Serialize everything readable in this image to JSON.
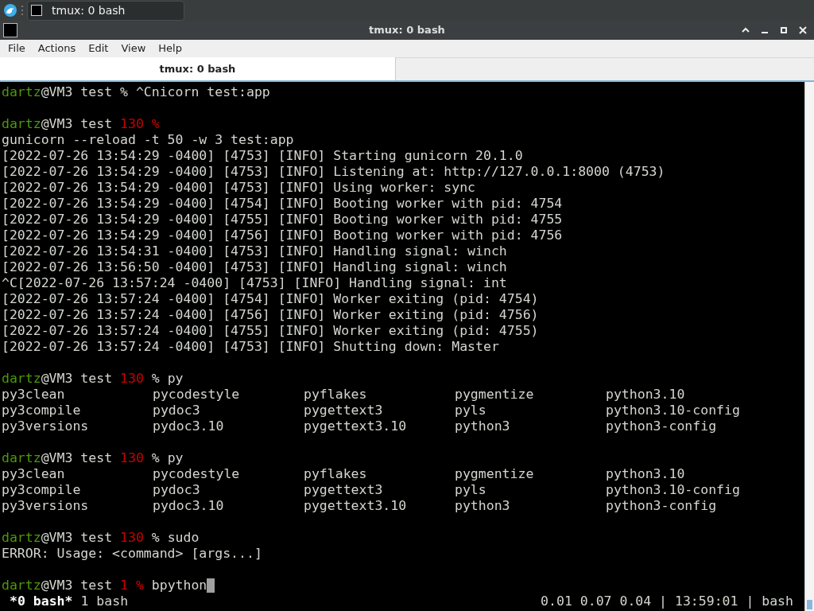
{
  "taskbar": {
    "task": {
      "label": "tmux: 0 bash",
      "selected": true
    }
  },
  "window": {
    "title": "tmux: 0 bash"
  },
  "menu": [
    "File",
    "Actions",
    "Edit",
    "View",
    "Help"
  ],
  "tabs": [
    {
      "label": "tmux: 0 bash",
      "selected": true
    }
  ],
  "terminal": [
    {
      "kind": "text",
      "segments": [
        {
          "text": "dartz",
          "color": "#4e9a06"
        },
        {
          "text": "@VM3 test % ^Cnicorn test:app",
          "color": "#d3d7cf"
        }
      ]
    },
    {
      "kind": "blank"
    },
    {
      "kind": "text",
      "segments": [
        {
          "text": "dartz",
          "color": "#4e9a06"
        },
        {
          "text": "@VM3 test ",
          "color": "#d3d7cf"
        },
        {
          "text": "130 %",
          "color": "#cc0000"
        }
      ]
    },
    {
      "kind": "text",
      "segments": [
        {
          "text": "gunicorn --reload -t 50 -w 3 test:app",
          "color": "#d3d7cf"
        }
      ]
    },
    {
      "kind": "text",
      "segments": [
        {
          "text": "[2022-07-26 13:54:29 -0400] [4753] [INFO] Starting gunicorn 20.1.0",
          "color": "#d3d7cf"
        }
      ]
    },
    {
      "kind": "text",
      "segments": [
        {
          "text": "[2022-07-26 13:54:29 -0400] [4753] [INFO] Listening at: http://127.0.0.1:8000 (4753)",
          "color": "#d3d7cf"
        }
      ]
    },
    {
      "kind": "text",
      "segments": [
        {
          "text": "[2022-07-26 13:54:29 -0400] [4753] [INFO] Using worker: sync",
          "color": "#d3d7cf"
        }
      ]
    },
    {
      "kind": "text",
      "segments": [
        {
          "text": "[2022-07-26 13:54:29 -0400] [4754] [INFO] Booting worker with pid: 4754",
          "color": "#d3d7cf"
        }
      ]
    },
    {
      "kind": "text",
      "segments": [
        {
          "text": "[2022-07-26 13:54:29 -0400] [4755] [INFO] Booting worker with pid: 4755",
          "color": "#d3d7cf"
        }
      ]
    },
    {
      "kind": "text",
      "segments": [
        {
          "text": "[2022-07-26 13:54:29 -0400] [4756] [INFO] Booting worker with pid: 4756",
          "color": "#d3d7cf"
        }
      ]
    },
    {
      "kind": "text",
      "segments": [
        {
          "text": "[2022-07-26 13:54:31 -0400] [4753] [INFO] Handling signal: winch",
          "color": "#d3d7cf"
        }
      ]
    },
    {
      "kind": "text",
      "segments": [
        {
          "text": "[2022-07-26 13:56:50 -0400] [4753] [INFO] Handling signal: winch",
          "color": "#d3d7cf"
        }
      ]
    },
    {
      "kind": "text",
      "segments": [
        {
          "text": "^C[2022-07-26 13:57:24 -0400] [4753] [INFO] Handling signal: int",
          "color": "#d3d7cf"
        }
      ]
    },
    {
      "kind": "text",
      "segments": [
        {
          "text": "[2022-07-26 13:57:24 -0400] [4754] [INFO] Worker exiting (pid: 4754)",
          "color": "#d3d7cf"
        }
      ]
    },
    {
      "kind": "text",
      "segments": [
        {
          "text": "[2022-07-26 13:57:24 -0400] [4756] [INFO] Worker exiting (pid: 4756)",
          "color": "#d3d7cf"
        }
      ]
    },
    {
      "kind": "text",
      "segments": [
        {
          "text": "[2022-07-26 13:57:24 -0400] [4755] [INFO] Worker exiting (pid: 4755)",
          "color": "#d3d7cf"
        }
      ]
    },
    {
      "kind": "text",
      "segments": [
        {
          "text": "[2022-07-26 13:57:24 -0400] [4753] [INFO] Shutting down: Master",
          "color": "#d3d7cf"
        }
      ]
    },
    {
      "kind": "blank"
    },
    {
      "kind": "text",
      "segments": [
        {
          "text": "dartz",
          "color": "#4e9a06"
        },
        {
          "text": "@VM3 test ",
          "color": "#d3d7cf"
        },
        {
          "text": "130",
          "color": "#cc0000"
        },
        {
          "text": " % py",
          "color": "#d3d7cf"
        }
      ]
    },
    {
      "kind": "columns",
      "cells": [
        "py3clean",
        "pycodestyle",
        "pyflakes",
        "pygmentize",
        "python3.10"
      ]
    },
    {
      "kind": "columns",
      "cells": [
        "py3compile",
        "pydoc3",
        "pygettext3",
        "pyls",
        "python3.10-config"
      ]
    },
    {
      "kind": "columns",
      "cells": [
        "py3versions",
        "pydoc3.10",
        "pygettext3.10",
        "python3",
        "python3-config"
      ]
    },
    {
      "kind": "blank"
    },
    {
      "kind": "text",
      "segments": [
        {
          "text": "dartz",
          "color": "#4e9a06"
        },
        {
          "text": "@VM3 test ",
          "color": "#d3d7cf"
        },
        {
          "text": "130",
          "color": "#cc0000"
        },
        {
          "text": " % py",
          "color": "#d3d7cf"
        }
      ]
    },
    {
      "kind": "columns",
      "cells": [
        "py3clean",
        "pycodestyle",
        "pyflakes",
        "pygmentize",
        "python3.10"
      ]
    },
    {
      "kind": "columns",
      "cells": [
        "py3compile",
        "pydoc3",
        "pygettext3",
        "pyls",
        "python3.10-config"
      ]
    },
    {
      "kind": "columns",
      "cells": [
        "py3versions",
        "pydoc3.10",
        "pygettext3.10",
        "python3",
        "python3-config"
      ]
    },
    {
      "kind": "blank"
    },
    {
      "kind": "text",
      "segments": [
        {
          "text": "dartz",
          "color": "#4e9a06"
        },
        {
          "text": "@VM3 test ",
          "color": "#d3d7cf"
        },
        {
          "text": "130",
          "color": "#cc0000"
        },
        {
          "text": " % sudo",
          "color": "#d3d7cf"
        }
      ]
    },
    {
      "kind": "text",
      "segments": [
        {
          "text": "ERROR: Usage: <command> [args...]",
          "color": "#d3d7cf"
        }
      ]
    },
    {
      "kind": "blank"
    },
    {
      "kind": "prompt",
      "cursor": true,
      "segments": [
        {
          "text": "dartz",
          "color": "#4e9a06"
        },
        {
          "text": "@VM3 test ",
          "color": "#d3d7cf"
        },
        {
          "text": "1 %",
          "color": "#cc0000"
        },
        {
          "text": " bpython",
          "color": "#d3d7cf"
        }
      ]
    }
  ],
  "status_bar": {
    "windows": [
      {
        "label": "*0 bash*",
        "selected": true
      },
      {
        "label": "1 bash",
        "selected": false
      }
    ],
    "right": "0.01 0.07 0.04 | 13:59:01 | bash"
  }
}
